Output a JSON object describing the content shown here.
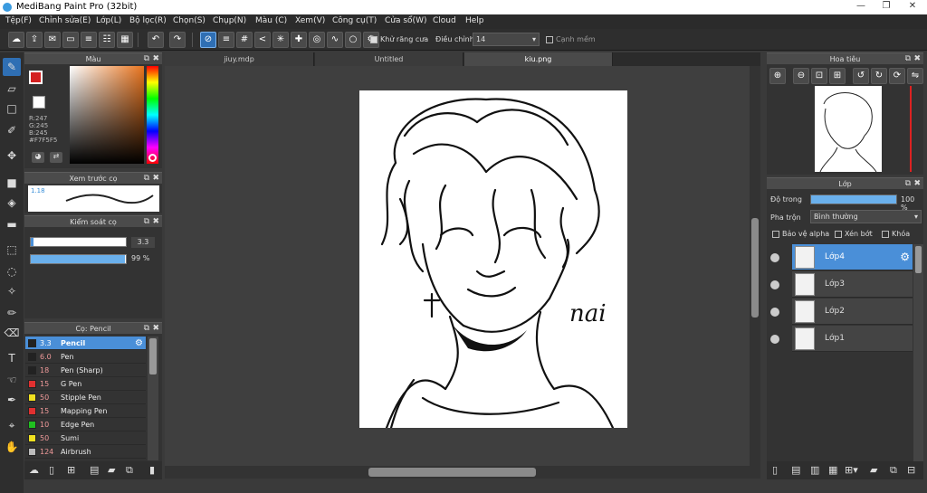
{
  "app": {
    "title": "MediBang Paint Pro (32bit)"
  },
  "window": {
    "minimize": "—",
    "maximize": "❐",
    "close": "✕"
  },
  "menu": [
    "Tệp(F)",
    "Chỉnh sửa(E)",
    "Lớp(L)",
    "Bộ lọc(R)",
    "Chọn(S)",
    "Chụp(N)",
    "Màu (C)",
    "Xem(V)",
    "Công cụ(T)",
    "Cửa sổ(W)",
    "Cloud",
    "Help"
  ],
  "toolbar": {
    "antialias_label": "Khử răng cưa",
    "adjust_label": "Điều chỉnh",
    "adjust_value": "14",
    "edge_label": "Cạnh mềm"
  },
  "tabs": [
    "jiuy.mdp",
    "Untitled",
    "kiu.png"
  ],
  "color_panel": {
    "title": "Màu",
    "r": "R:247",
    "g": "G:245",
    "b": "B:245",
    "hex": "#F7F5F5",
    "fg": "#d42020",
    "bg": "#ffffff"
  },
  "brush_preview": {
    "title": "Xem trước cọ",
    "size": "1.18"
  },
  "brush_control": {
    "title": "Kiểm soát cọ",
    "size": "3.3",
    "opacity": "99 %",
    "size_fraction": 0.03,
    "opacity_fraction": 0.99
  },
  "brush_panel": {
    "title": "Cọ: Pencil",
    "items": [
      {
        "size": "3.3",
        "name": "Pencil",
        "color": "#222222"
      },
      {
        "size": "6.0",
        "name": "Pen",
        "color": "#222222"
      },
      {
        "size": "18",
        "name": "Pen (Sharp)",
        "color": "#222222"
      },
      {
        "size": "15",
        "name": "G Pen",
        "color": "#e03030"
      },
      {
        "size": "50",
        "name": "Stipple Pen",
        "color": "#f0e020"
      },
      {
        "size": "15",
        "name": "Mapping Pen",
        "color": "#e03030"
      },
      {
        "size": "10",
        "name": "Edge Pen",
        "color": "#20c020"
      },
      {
        "size": "50",
        "name": "Sumi",
        "color": "#f0e020"
      },
      {
        "size": "124",
        "name": "Airbrush",
        "color": "#bbbbbb"
      }
    ]
  },
  "navigator": {
    "title": "Hoa tiêu"
  },
  "layers": {
    "title": "Lớp",
    "opacity_label": "Độ trong",
    "opacity_value": "100 %",
    "opacity_fraction": 1.0,
    "blend_label": "Pha trộn",
    "blend_value": "Bình thường",
    "protect_alpha": "Bảo vệ alpha",
    "clipping": "Xén bớt",
    "lock": "Khóa",
    "items": [
      "Lớp4",
      "Lớp3",
      "Lớp2",
      "Lớp1"
    ]
  },
  "canvas": {
    "signature": "nai"
  }
}
